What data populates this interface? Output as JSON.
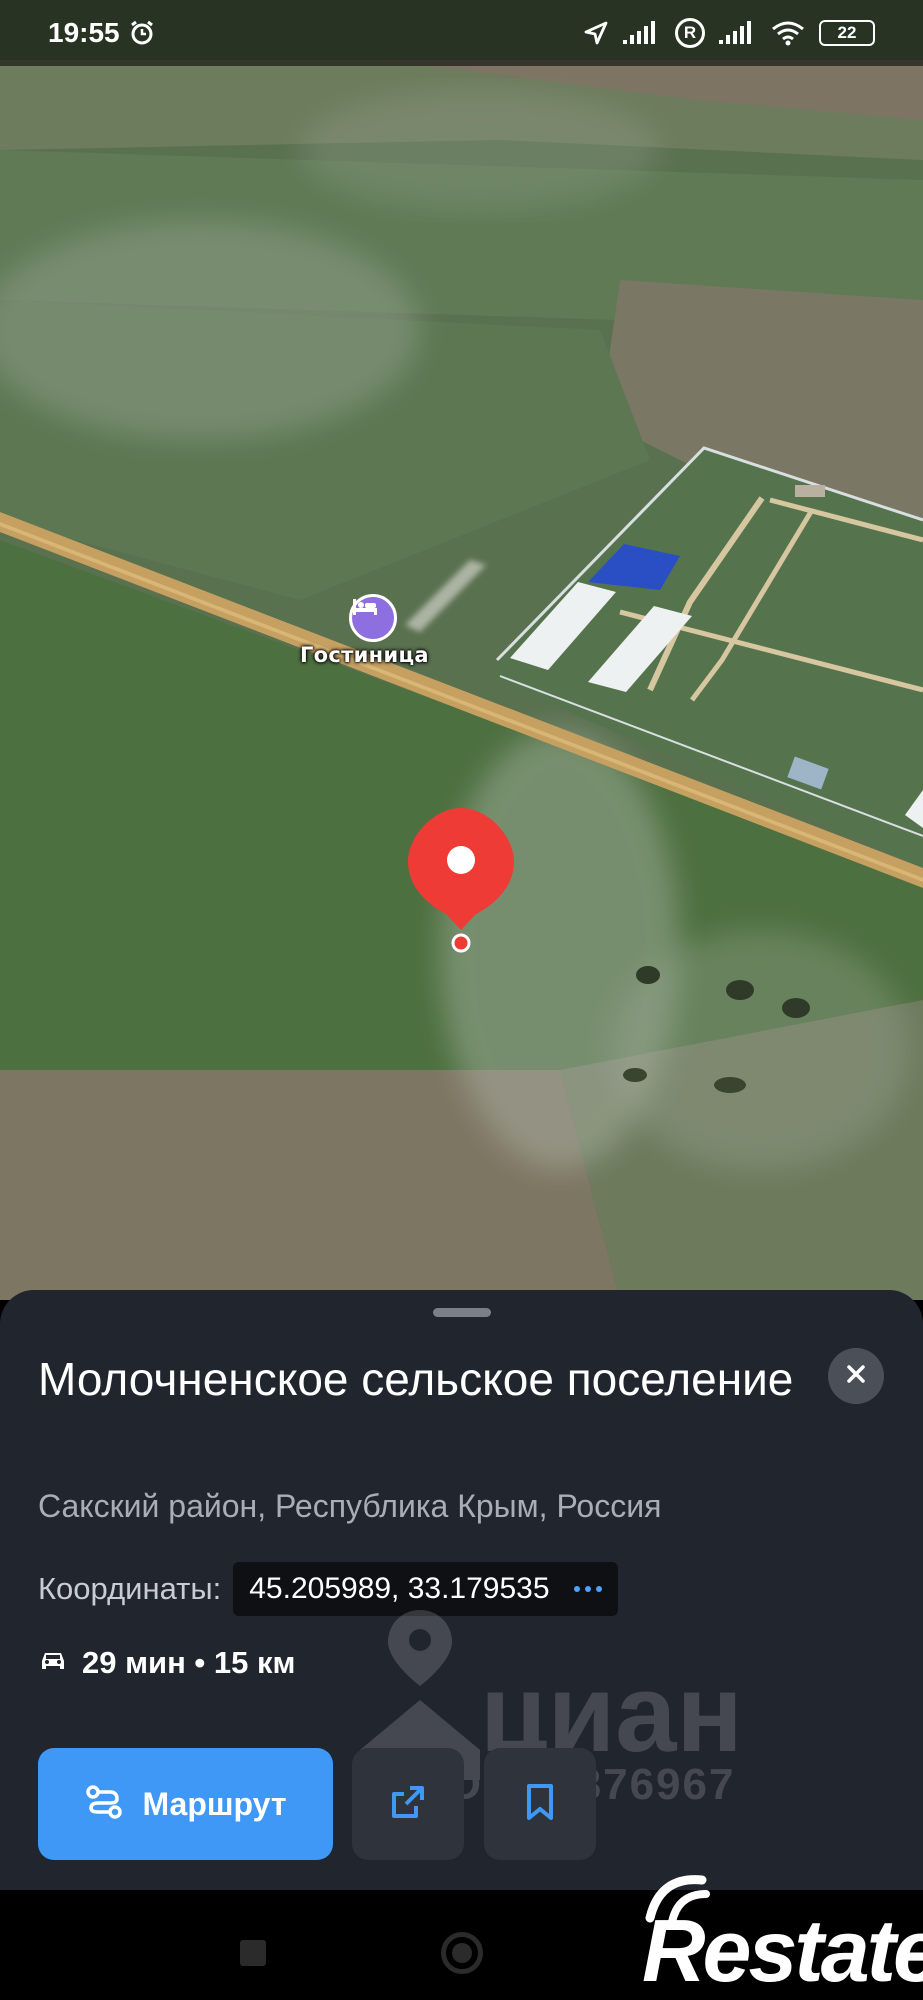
{
  "status_bar": {
    "time": "19:55",
    "roaming_badge": "R",
    "battery": "22",
    "icons": [
      "alarm-icon",
      "location-arrow-icon",
      "signal-icon",
      "roaming-icon",
      "signal-icon",
      "wifi-icon",
      "battery-icon"
    ]
  },
  "map": {
    "poi_label": "Гостиница",
    "poi_icon": "bed-icon",
    "marker_icon": "map-pin-icon",
    "marker_color": "#ef3b36"
  },
  "place_card": {
    "title": "Молочненское сельское поселение",
    "address": "Сакский район, Республика Крым, Россия",
    "coords_label": "Координаты:",
    "coords_value": "45.205989, 33.179535",
    "drive_time": "29 мин • 15 км",
    "drive_icon": "car-icon",
    "close_icon": "close-icon",
    "route_button": {
      "label": "Маршрут",
      "icon": "route-icon"
    },
    "share_icon": "share-icon",
    "bookmark_icon": "bookmark-icon",
    "accent_color": "#3f98f5"
  },
  "watermark": {
    "brand": "циан",
    "listing_id": "ID 300876967"
  },
  "corner_logo": "Restate"
}
